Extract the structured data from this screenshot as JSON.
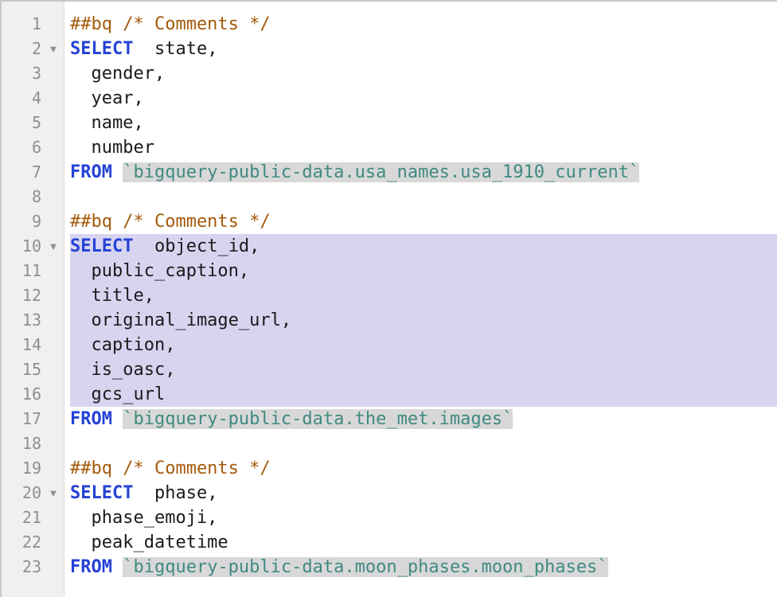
{
  "editor": {
    "fold_icon": "fold-triangle-down",
    "lines": [
      {
        "num": "1",
        "fold": false,
        "selected": false,
        "parts": [
          {
            "t": "cm",
            "v": "##bq /* Comments */"
          }
        ]
      },
      {
        "num": "2",
        "fold": true,
        "selected": false,
        "parts": [
          {
            "t": "kw",
            "v": "SELECT"
          },
          {
            "t": "tx",
            "v": "  state,"
          }
        ]
      },
      {
        "num": "3",
        "fold": false,
        "selected": false,
        "parts": [
          {
            "t": "tx",
            "v": "  gender,"
          }
        ]
      },
      {
        "num": "4",
        "fold": false,
        "selected": false,
        "parts": [
          {
            "t": "tx",
            "v": "  year,"
          }
        ]
      },
      {
        "num": "5",
        "fold": false,
        "selected": false,
        "parts": [
          {
            "t": "tx",
            "v": "  name,"
          }
        ]
      },
      {
        "num": "6",
        "fold": false,
        "selected": false,
        "parts": [
          {
            "t": "tx",
            "v": "  number"
          }
        ]
      },
      {
        "num": "7",
        "fold": false,
        "selected": false,
        "parts": [
          {
            "t": "kw",
            "v": "FROM"
          },
          {
            "t": "tx",
            "v": " "
          },
          {
            "t": "bt",
            "v": "`bigquery-public-data.usa_names.usa_1910_current`"
          }
        ]
      },
      {
        "num": "8",
        "fold": false,
        "selected": false,
        "parts": []
      },
      {
        "num": "9",
        "fold": false,
        "selected": false,
        "parts": [
          {
            "t": "cm",
            "v": "##bq /* Comments */"
          }
        ]
      },
      {
        "num": "10",
        "fold": true,
        "selected": true,
        "parts": [
          {
            "t": "kw",
            "v": "SELECT"
          },
          {
            "t": "tx",
            "v": "  object_id,"
          }
        ]
      },
      {
        "num": "11",
        "fold": false,
        "selected": true,
        "parts": [
          {
            "t": "tx",
            "v": "  public_caption,"
          }
        ]
      },
      {
        "num": "12",
        "fold": false,
        "selected": true,
        "parts": [
          {
            "t": "tx",
            "v": "  title,"
          }
        ]
      },
      {
        "num": "13",
        "fold": false,
        "selected": true,
        "parts": [
          {
            "t": "tx",
            "v": "  original_image_url,"
          }
        ]
      },
      {
        "num": "14",
        "fold": false,
        "selected": true,
        "parts": [
          {
            "t": "tx",
            "v": "  caption,"
          }
        ]
      },
      {
        "num": "15",
        "fold": false,
        "selected": true,
        "parts": [
          {
            "t": "tx",
            "v": "  is_oasc,"
          }
        ]
      },
      {
        "num": "16",
        "fold": false,
        "selected": true,
        "parts": [
          {
            "t": "tx",
            "v": "  gcs_url"
          }
        ]
      },
      {
        "num": "17",
        "fold": false,
        "selected": false,
        "parts": [
          {
            "t": "kw",
            "v": "FROM"
          },
          {
            "t": "tx",
            "v": " "
          },
          {
            "t": "bt",
            "v": "`bigquery-public-data.the_met.images`"
          }
        ]
      },
      {
        "num": "18",
        "fold": false,
        "selected": false,
        "parts": []
      },
      {
        "num": "19",
        "fold": false,
        "selected": false,
        "parts": [
          {
            "t": "cm",
            "v": "##bq /* Comments */"
          }
        ]
      },
      {
        "num": "20",
        "fold": true,
        "selected": false,
        "parts": [
          {
            "t": "kw",
            "v": "SELECT"
          },
          {
            "t": "tx",
            "v": "  phase,"
          }
        ]
      },
      {
        "num": "21",
        "fold": false,
        "selected": false,
        "parts": [
          {
            "t": "tx",
            "v": "  phase_emoji,"
          }
        ]
      },
      {
        "num": "22",
        "fold": false,
        "selected": false,
        "parts": [
          {
            "t": "tx",
            "v": "  peak_datetime"
          }
        ]
      },
      {
        "num": "23",
        "fold": false,
        "selected": false,
        "parts": [
          {
            "t": "kw",
            "v": "FROM"
          },
          {
            "t": "tx",
            "v": " "
          },
          {
            "t": "bt",
            "v": "`bigquery-public-data.moon_phases.moon_phases`"
          }
        ]
      }
    ]
  },
  "colors": {
    "keyword": "#2442d6",
    "comment": "#a45a0b",
    "identifier": "#3f8a82",
    "selection": "#d7d4f0",
    "identifier_bg": "#d8d8d8",
    "gutter_bg": "#f0f0f0"
  }
}
